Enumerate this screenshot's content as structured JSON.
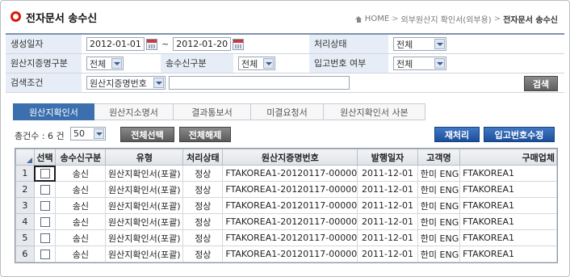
{
  "header": {
    "title": "전자문서 송수신",
    "breadcrumb": [
      "HOME",
      "외부원산지 확인서(외부용)",
      "전자문서 송수신"
    ]
  },
  "search": {
    "date_label": "생성일자",
    "date_from": "2012-01-01",
    "date_to": "2012-01-20",
    "status_label": "처리상태",
    "status_value": "전체",
    "origin_type_label": "원산지증명구분",
    "origin_type_value": "전체",
    "send_type_label": "송수신구분",
    "send_type_value": "전체",
    "inbound_label": "입고번호 여부",
    "inbound_value": "전체",
    "condition_label": "검색조건",
    "condition_value": "원산지증명번호",
    "keyword_value": "",
    "search_button": "검색"
  },
  "tabs": [
    {
      "label": "원산지확인서",
      "active": true
    },
    {
      "label": "원산지소명서",
      "active": false
    },
    {
      "label": "결과통보서",
      "active": false
    },
    {
      "label": "미결요청서",
      "active": false
    },
    {
      "label": "원산지확인서 사본",
      "active": false
    }
  ],
  "toolbar": {
    "total_count": "총건수 : 6 건",
    "page_size": "50",
    "select_all": "전체선택",
    "deselect_all": "전체해제",
    "reprocess": "재처리",
    "edit_inbound": "입고번호수정"
  },
  "table": {
    "columns": [
      "",
      "선택",
      "송수신구분",
      "유형",
      "처리상태",
      "원산지증명번호",
      "발행일자",
      "고객명",
      "구매업체"
    ],
    "rows": [
      {
        "n": "1",
        "direction": "송신",
        "type": "원산지확인서(포괄)",
        "status": "정상",
        "cert_no": "FTAKOREA1-20120117-00000",
        "date": "2011-12-01",
        "customer": "한미 ENG",
        "buyer": "FTAKOREA1"
      },
      {
        "n": "2",
        "direction": "송신",
        "type": "원산지확인서(포괄)",
        "status": "정상",
        "cert_no": "FTAKOREA1-20120117-00000",
        "date": "2011-12-01",
        "customer": "한미 ENG",
        "buyer": "FTAKOREA1"
      },
      {
        "n": "3",
        "direction": "송신",
        "type": "원산지확인서(포괄)",
        "status": "정상",
        "cert_no": "FTAKOREA1-20120117-00000",
        "date": "2011-12-01",
        "customer": "한미 ENG",
        "buyer": "FTAKOREA1"
      },
      {
        "n": "4",
        "direction": "송신",
        "type": "원산지확인서(포괄)",
        "status": "정상",
        "cert_no": "FTAKOREA1-20120117-00000",
        "date": "2011-12-01",
        "customer": "한미 ENG",
        "buyer": "FTAKOREA1"
      },
      {
        "n": "5",
        "direction": "송신",
        "type": "원산지확인서(포괄)",
        "status": "정상",
        "cert_no": "FTAKOREA1-20120117-00000",
        "date": "2011-12-01",
        "customer": "한미 ENG",
        "buyer": "FTAKOREA1"
      },
      {
        "n": "6",
        "direction": "송신",
        "type": "원산지확인서(포괄)",
        "status": "정상",
        "cert_no": "FTAKOREA1-20120117-00000",
        "date": "2011-12-01",
        "customer": "한미 ENG",
        "buyer": "FTAKOREA1"
      }
    ]
  }
}
